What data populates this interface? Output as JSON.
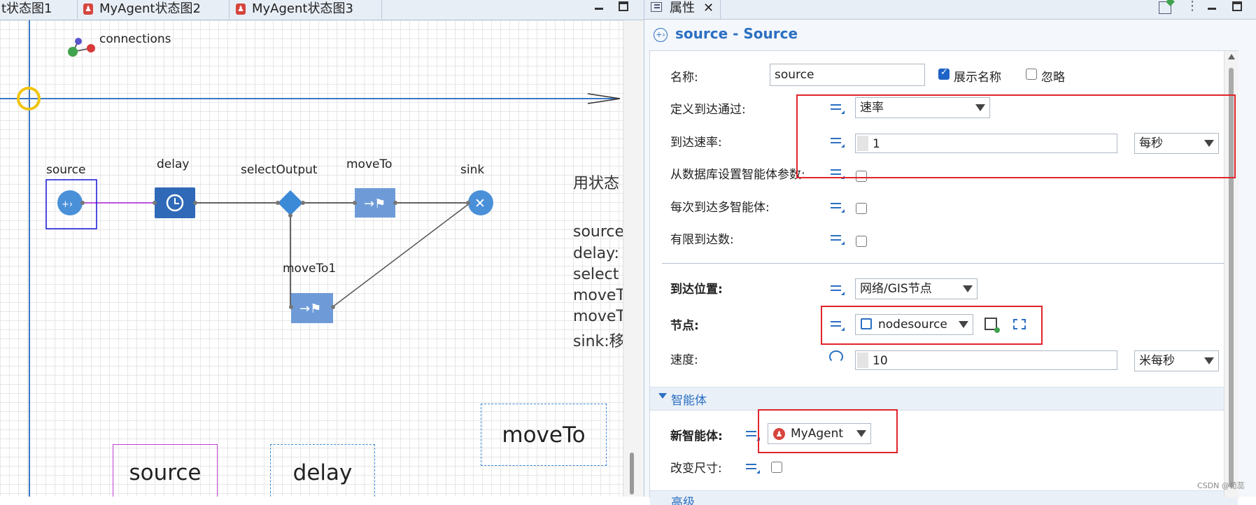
{
  "editor": {
    "tabs": [
      {
        "label": "t状态图1"
      },
      {
        "label": "MyAgent状态图2"
      },
      {
        "label": "MyAgent状态图3"
      }
    ],
    "connections_label": "connections",
    "nodes": {
      "source": "source",
      "delay": "delay",
      "selectOutput": "selectOutput",
      "moveTo": "moveTo",
      "sink": "sink",
      "moveTo1": "moveTo1"
    },
    "side_text": {
      "line0": "用状态",
      "line1": "source",
      "line2": "delay:",
      "line3": "select",
      "line4": "moveT",
      "line5": "moveT",
      "line6": "sink:移"
    },
    "big_labels": {
      "source": "source",
      "delay": "delay",
      "moveTo": "moveTo"
    }
  },
  "panel": {
    "tab_label": "属性",
    "title": "source - Source",
    "name_label": "名称:",
    "name_value": "source",
    "show_name_label": "展示名称",
    "show_name_checked": true,
    "ignore_label": "忽略",
    "ignore_checked": false,
    "arrival_defined_label": "定义到达通过:",
    "arrival_defined_value": "速率",
    "arrival_rate_label": "到达速率:",
    "arrival_rate_value": "1",
    "arrival_rate_unit": "每秒",
    "db_params_label": "从数据库设置智能体参数:",
    "multi_agents_label": "每次到达多智能体:",
    "limited_label": "有限到达数:",
    "location_label": "到达位置:",
    "location_value": "网络/GIS节点",
    "node_label": "节点:",
    "node_value": "nodesource",
    "speed_label": "速度:",
    "speed_value": "10",
    "speed_unit": "米每秒",
    "section_agent": "智能体",
    "new_agent_label": "新智能体:",
    "new_agent_value": "MyAgent",
    "resize_label": "改变尺寸:",
    "next_section": "高级",
    "watermark": "CSDN @荀蕊"
  },
  "colors": {
    "accent": "#1f63c6",
    "highlight_red": "#e0242b",
    "node_blue": "#4a90d9",
    "node_dark": "#2f69b8"
  }
}
